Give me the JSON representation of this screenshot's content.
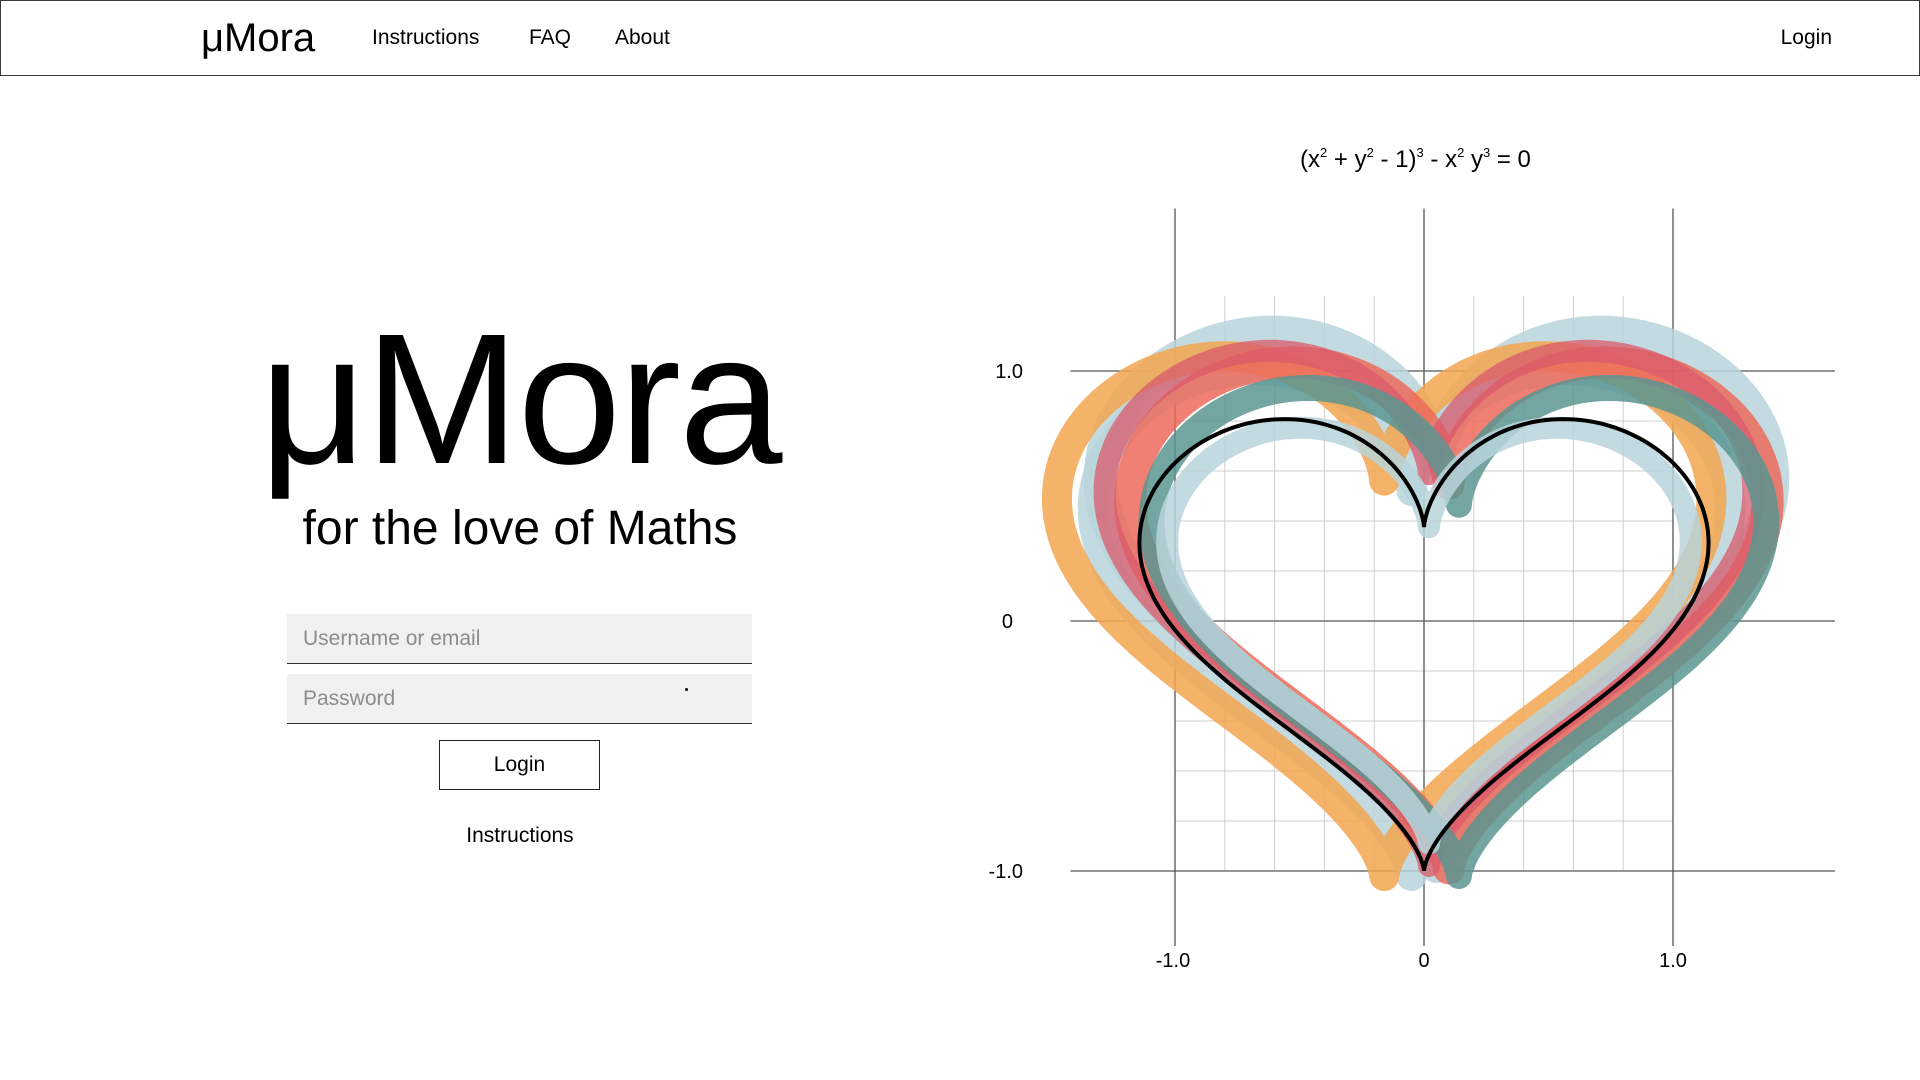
{
  "navbar": {
    "brand": "μMora",
    "links": [
      "Instructions",
      "FAQ",
      "About"
    ],
    "login": "Login"
  },
  "hero": {
    "title": "μMora",
    "subtitle": "for the love of Maths"
  },
  "login_form": {
    "username_placeholder": "Username or email",
    "password_placeholder": "Password",
    "submit_label": "Login",
    "instructions_link": "Instructions"
  },
  "chart_data": {
    "type": "line",
    "equation_parts": [
      "(x",
      "2",
      " + y",
      "2",
      " - 1)",
      "3",
      " - x",
      "2",
      " y",
      "3",
      " = 0"
    ],
    "x_ticks": [
      "-1.0",
      "0",
      "1.0"
    ],
    "y_ticks": [
      "1.0",
      "0",
      "-1.0"
    ],
    "x_tick_values": [
      -1,
      0,
      1
    ],
    "y_tick_values": [
      1,
      0,
      -1
    ],
    "grid": true,
    "curve_color": "#000000",
    "band_colors": {
      "light_blue": "#b9d3db",
      "orange": "#f3a54f",
      "coral": "#ec6a5a",
      "red": "#d9596b",
      "teal": "#5a9590"
    }
  }
}
